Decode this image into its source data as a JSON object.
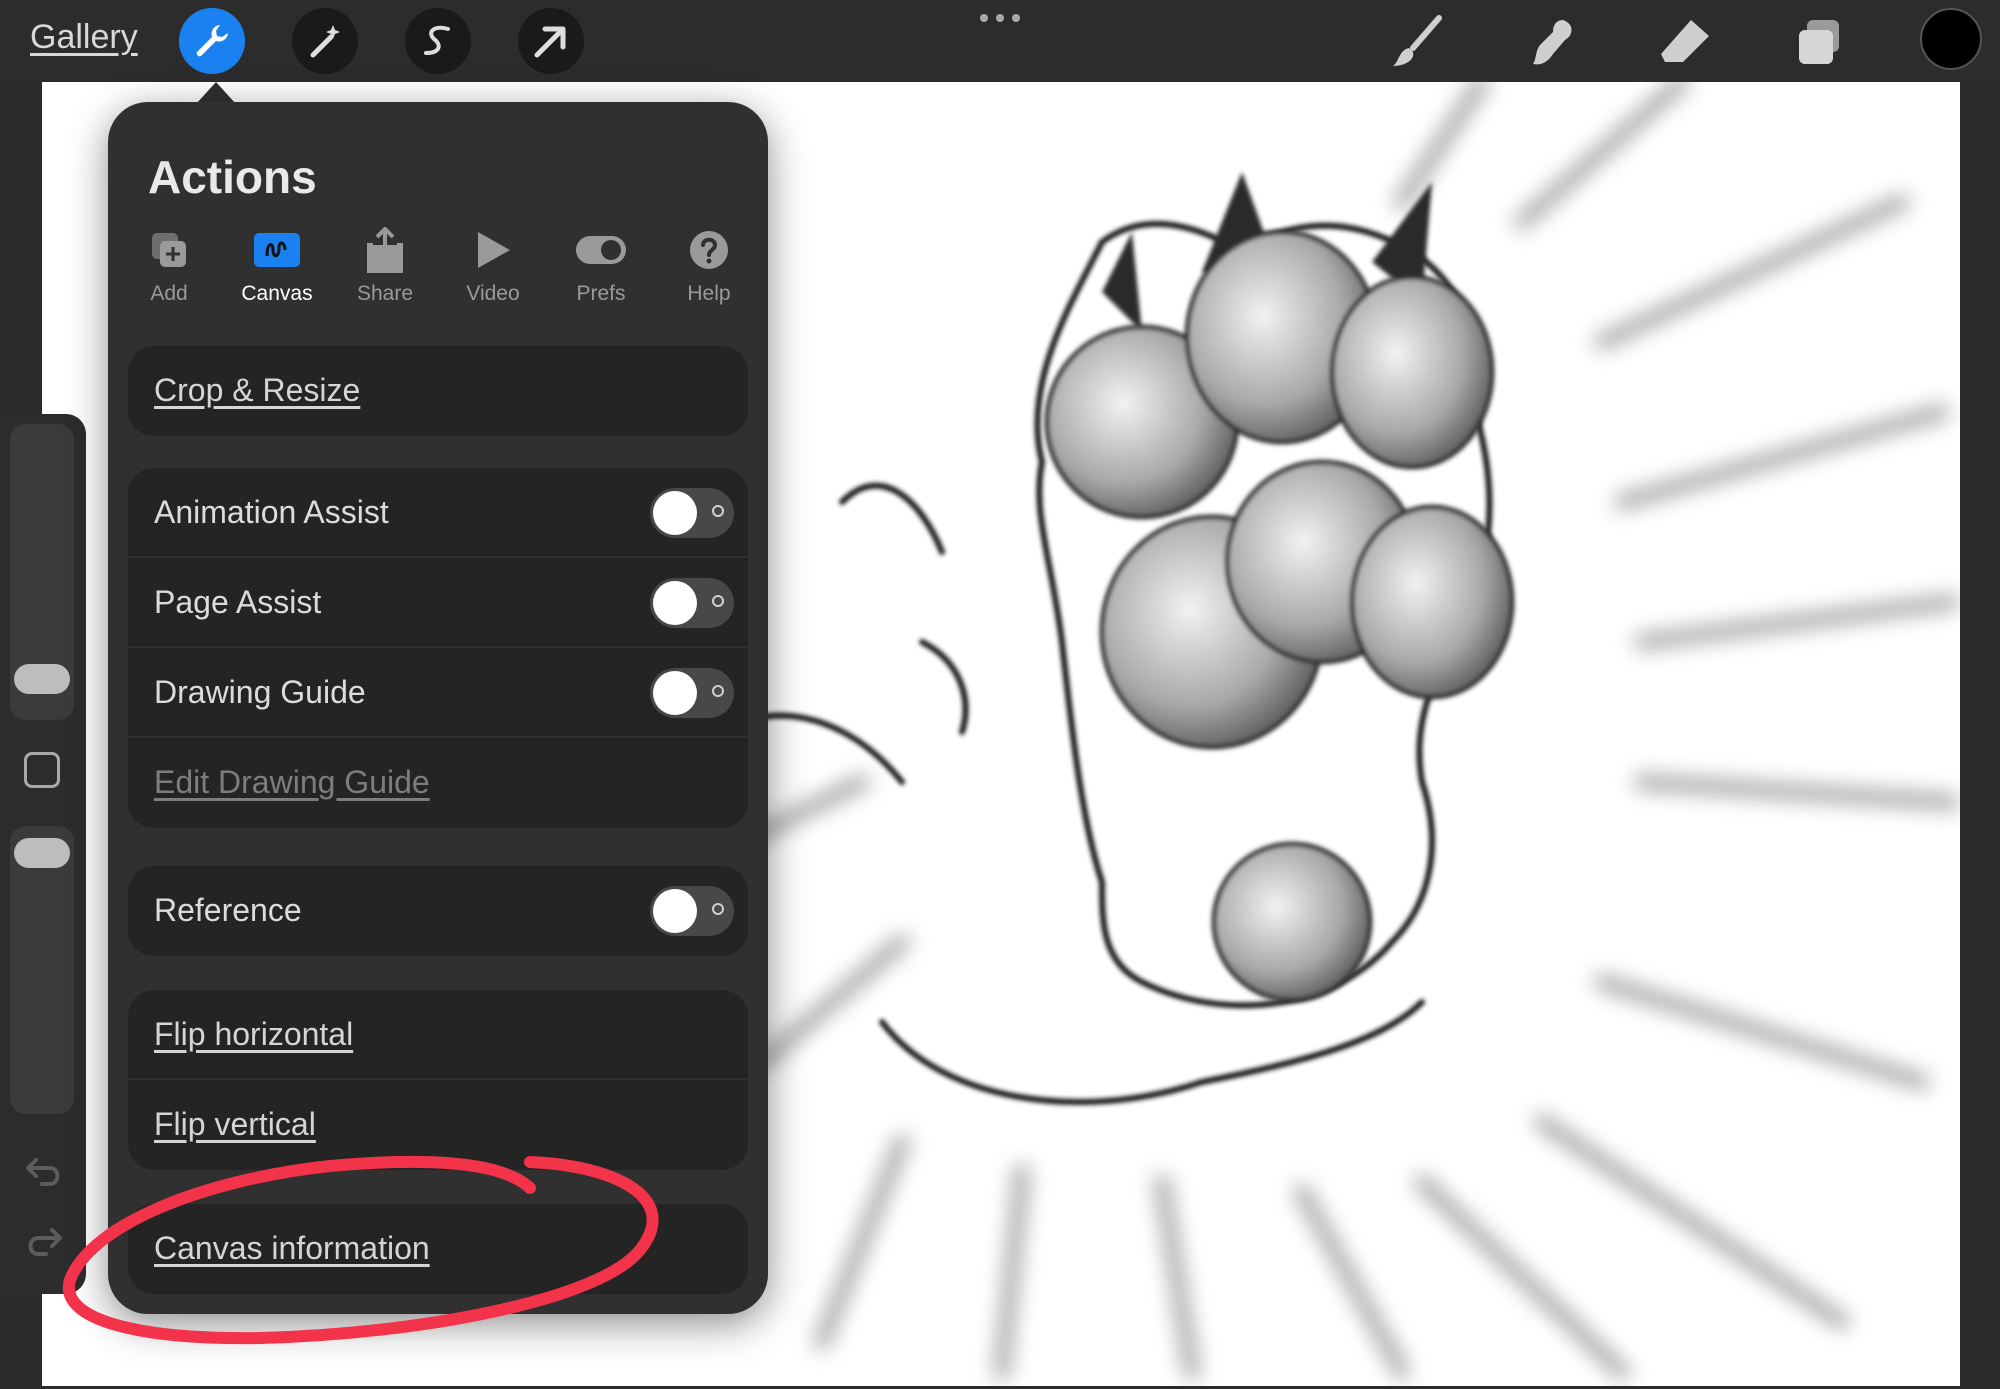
{
  "topbar": {
    "gallery_label": "Gallery",
    "tools_left": [
      "wrench-icon",
      "magic-wand-icon",
      "selection-icon",
      "transform-arrow-icon"
    ],
    "tools_right": [
      "brush-icon",
      "smudge-icon",
      "eraser-icon",
      "layers-icon"
    ],
    "more_icon": "ellipsis-icon",
    "color_swatch": "#000000",
    "active_tool_color": "#1a82f0"
  },
  "actions_panel": {
    "title": "Actions",
    "tabs": [
      {
        "label": "Add",
        "icon": "add-icon"
      },
      {
        "label": "Canvas",
        "icon": "canvas-icon",
        "selected": true
      },
      {
        "label": "Share",
        "icon": "share-icon"
      },
      {
        "label": "Video",
        "icon": "play-icon"
      },
      {
        "label": "Prefs",
        "icon": "toggle-icon"
      },
      {
        "label": "Help",
        "icon": "help-icon"
      }
    ],
    "crop": "Crop & Resize",
    "animation_assist": {
      "label": "Animation Assist",
      "on": false
    },
    "page_assist": {
      "label": "Page Assist",
      "on": false
    },
    "drawing_guide": {
      "label": "Drawing Guide",
      "on": false
    },
    "edit_drawing_guide": "Edit Drawing Guide",
    "reference": {
      "label": "Reference",
      "on": false
    },
    "flip_horizontal": "Flip horizontal",
    "flip_vertical": "Flip vertical",
    "canvas_information": "Canvas information"
  },
  "highlight": {
    "color": "#f2334a",
    "icon": "red-annotation-ellipse"
  }
}
